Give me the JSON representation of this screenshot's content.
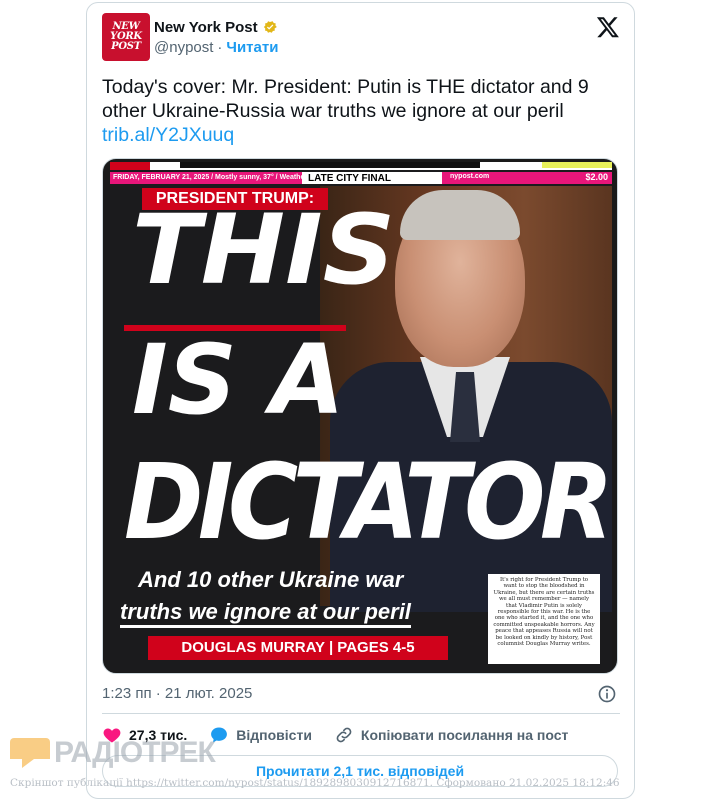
{
  "account": {
    "logo_lines": [
      "NEW",
      "YORK",
      "POST"
    ],
    "name": "New York Post",
    "handle": "@nypost",
    "separator": "·",
    "follow_label": "Читати"
  },
  "tweet": {
    "text": "Today's cover: Mr. President: Putin is THE dictator and 9 other Ukraine-Russia war truths we ignore at our peril",
    "link": "trib.al/Y2JXuuq"
  },
  "cover": {
    "dateline": "FRIDAY, FEBRUARY 21, 2025 / Mostly sunny, 37° / Weather: P. S2 ★★",
    "late_city": "LATE CITY FINAL",
    "site": "nypost.com",
    "price": "$2.00",
    "kicker": "PRESIDENT TRUMP:",
    "headline_1": "THIS",
    "headline_2": "IS A",
    "headline_3": "DICTATOR",
    "subhead_1": "And 10 other Ukraine war",
    "subhead_2": "truths we ignore at our peril",
    "byline": "DOUGLAS MURRAY | PAGES 4-5",
    "blurb": "It's right for President Trump to want to stop the bloodshed in Ukraine, but there are certain truths we all must remember — namely that Vladimir Putin is solely responsible for this war. He is the one who started it, and the one who committed unspeakable horrors. Any peace that appeases Russia will not be looked on kindly by history, Post columnist Douglas Murray writes."
  },
  "meta": {
    "timestamp": "1:23 пп · 21 лют. 2025"
  },
  "actions": {
    "likes": "27,3 тис.",
    "reply_label": "Відповісти",
    "copy_link_label": "Копіювати посилання на пост"
  },
  "replies_button": "Прочитати 2,1 тис. відповідей",
  "watermark": {
    "brand": "РАДІОТРЕК",
    "caption": "Скріншот публікації https://twitter.com/nypost/status/1892898030912716871. Сформовано 21.02.2025 18:12:46"
  },
  "colors": {
    "accent": "#1d9bf0",
    "like": "#f91880",
    "nyp_red": "#c8102e",
    "verified_gold": "#e2b719"
  },
  "icons": [
    "nypost-logo",
    "verified-badge-icon",
    "x-logo-icon",
    "info-icon",
    "heart-icon",
    "reply-bubble-icon",
    "link-icon"
  ]
}
